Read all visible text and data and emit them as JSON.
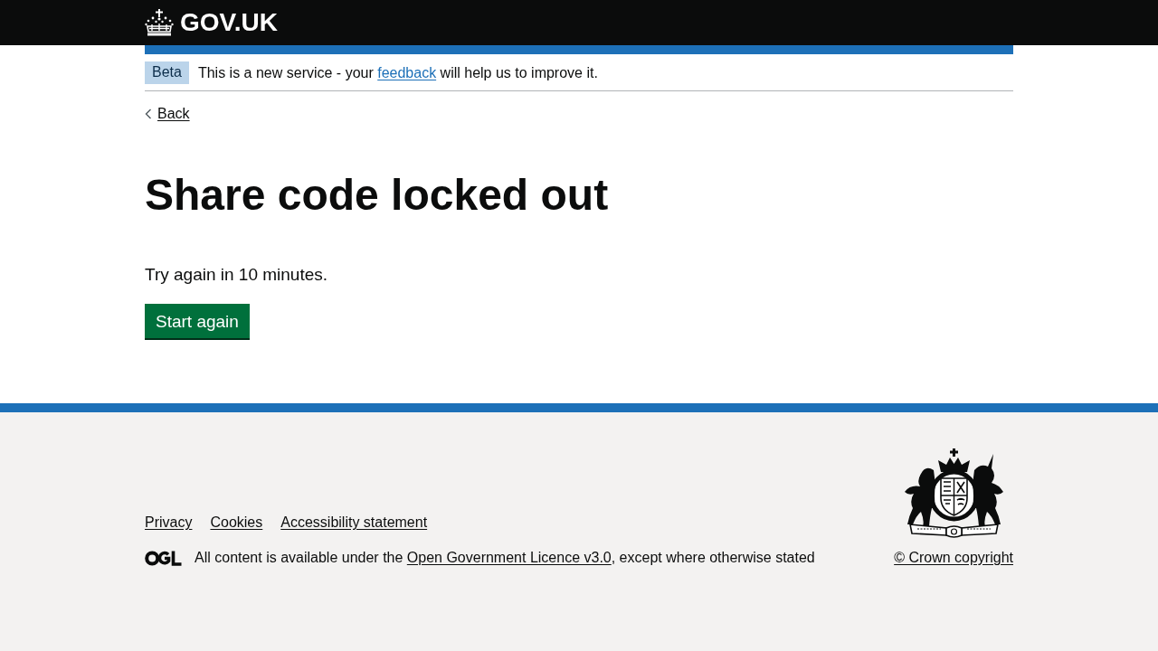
{
  "header": {
    "logo_text": "GOV.UK"
  },
  "phase_banner": {
    "tag": "Beta",
    "text_before": "This is a new service - your ",
    "link": "feedback",
    "text_after": " will help us to improve it."
  },
  "back_link": "Back",
  "heading": "Share code locked out",
  "body": "Try again in 10 minutes.",
  "button": "Start again",
  "footer": {
    "links": [
      "Privacy",
      "Cookies",
      "Accessibility statement"
    ],
    "licence": {
      "text_before": "All content is available under the ",
      "link": "Open Government Licence v3.0",
      "text_after": ", except where otherwise stated"
    },
    "copyright": "© Crown copyright"
  }
}
